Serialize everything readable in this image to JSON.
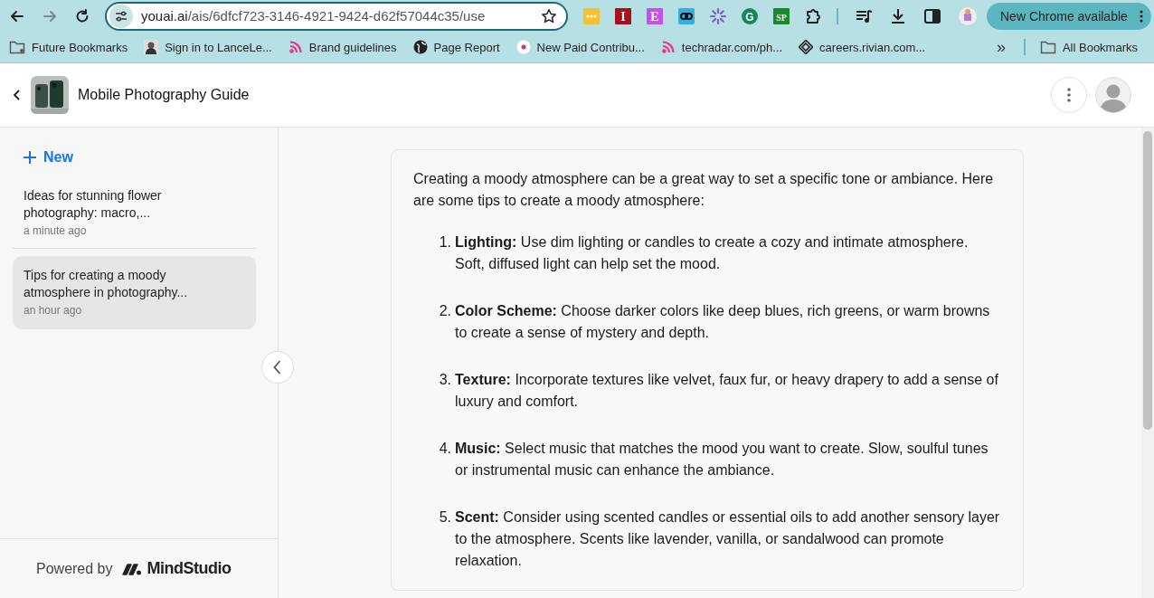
{
  "browser": {
    "url_host": "youai.ai",
    "url_path": "/ais/6dfcf723-3146-4921-9424-d62f57044c35/use",
    "extensions": [
      {
        "kind": "dots",
        "color": "#f2c230"
      },
      {
        "kind": "letter",
        "label": "I",
        "color": "#a5121e"
      },
      {
        "kind": "letter",
        "label": "E",
        "color": "#c552e8"
      },
      {
        "kind": "link",
        "color": "#2fb0e0"
      },
      {
        "kind": "burst",
        "color": "#7a5fc9"
      },
      {
        "kind": "circle-letter",
        "label": "G",
        "color": "#15885a"
      },
      {
        "kind": "letter",
        "label": "SP",
        "color": "#1a8a2c"
      },
      {
        "kind": "puzzle",
        "color": "#222222"
      }
    ],
    "update_button": "New Chrome available",
    "bookmarks": [
      {
        "kind": "folder",
        "label": "Future Bookmarks"
      },
      {
        "label": "Sign in to LanceLe..."
      },
      {
        "kind": "rss",
        "label": "Brand guidelines"
      },
      {
        "kind": "globe",
        "label": "Page Report"
      },
      {
        "kind": "dot",
        "label": "New Paid Contribu..."
      },
      {
        "kind": "rss",
        "label": "techradar.com/ph..."
      },
      {
        "kind": "diamond",
        "label": "careers.rivian.com..."
      }
    ],
    "more_bookmarks": "»",
    "all_bookmarks": "All Bookmarks"
  },
  "app": {
    "title": "Mobile Photography Guide"
  },
  "sidebar": {
    "new_label": "New",
    "items": [
      {
        "title": "Ideas for stunning flower photography: macro,...",
        "time": "a minute ago",
        "selected": false
      },
      {
        "title": "Tips for creating a moody atmosphere in photography...",
        "time": "an hour ago",
        "selected": true
      }
    ],
    "powered_by": "Powered by",
    "brand": "MindStudio"
  },
  "message": {
    "intro": "Creating a moody atmosphere can be a great way to set a specific tone or ambiance. Here are some tips to create a moody atmosphere:",
    "tips": [
      {
        "number": "1.",
        "text": "**Lighting:** Use dim lighting or candles to create a cozy and intimate atmosphere. Soft, diffused light can help set the mood."
      },
      {
        "number": "2.",
        "text": "**Color Scheme:** Choose darker colors like deep blues, rich greens, or warm browns to create a sense of mystery and depth."
      },
      {
        "number": "3.",
        "text": "**Texture:** Incorporate textures like velvet, faux fur, or heavy drapery to add a sense of luxury and comfort."
      },
      {
        "number": "4.",
        "text": "**Music:** Select music that matches the mood you want to create. Slow, soulful tunes or instrumental music can enhance the ambiance."
      },
      {
        "number": "5.",
        "text": "**Scent:** Consider using scented candles or essential oils to add another sensory layer to the atmosphere. Scents like lavender, vanilla, or sandalwood can promote relaxation."
      }
    ]
  }
}
